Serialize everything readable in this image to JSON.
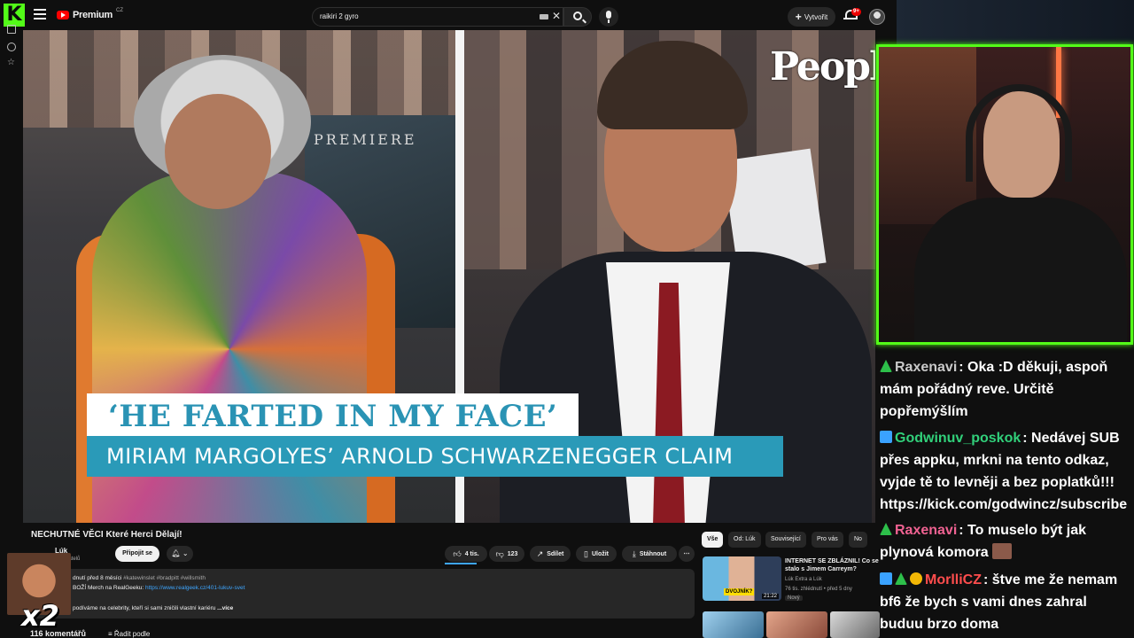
{
  "topbar": {
    "logo_letter": "K",
    "yt_word": "Premium",
    "yt_region": "CZ",
    "search_value": "raikiri 2 gyro",
    "create_label": "Vytvořit",
    "notif_badge": "9+"
  },
  "video": {
    "brand_logo": "People",
    "premiere_text": "PREMIERE",
    "caption_1": "‘HE FARTED IN MY FACE’",
    "caption_2": "MIRIAM MARGOLYES’ ARNOLD SCHWARZENEGGER CLAIM"
  },
  "below": {
    "title": "NECHUTNÉ VĚCI Které Herci Dělají!",
    "channel_name": "Lúk",
    "channel_subs": "odběratelů",
    "join_label": "Připojit se",
    "likes_label": "4 tis.",
    "dislikes_label": "123",
    "share_label": "Sdílet",
    "save_label": "Uložit",
    "download_label": "Stáhnout",
    "more_label": "⋯",
    "desc_line1_meta": "dnutí  před 8 měsíci",
    "desc_line1_tags": "#katewinslet #bradpitt #willsmith",
    "desc_line2_prefix": "BOŽÍ Merch na RealGeeku: ",
    "desc_line2_link": "https://www.realgeek.cz/401-lukuv-svet",
    "desc_line3": "podíváme na celebrity, kteří si sami zničili vlastní kariéru",
    "desc_more": "...více",
    "comments_label": "116 komentářů",
    "sort_label": "Řadit podle"
  },
  "recs": {
    "chips": [
      "Vše",
      "Od: Lúk",
      "Související",
      "Pro vás",
      "No"
    ],
    "item": {
      "title": "INTERNET SE ZBLÁZNIL! Co se stalo s Jimem Carreym?",
      "channel": "Lúk Extra a Lúk",
      "views": "76 tis. zhlédnutí • před 5 dny",
      "badge_new": "Nový",
      "thumb_tag": "DVOJNÍK?",
      "duration": "21:22"
    }
  },
  "overlay": {
    "emote_multiplier": "x2"
  },
  "chat": [
    {
      "user": "Raxenavi",
      "text": ": Oka :D děkuji, aspoň mám pořádný reve. Určitě popřemýšlím"
    },
    {
      "user": "Godwinuv_poskok",
      "text": ": Nedávej SUB přes appku, mrkni na tento odkaz, vyjde tě to levněji a bez poplatků!!! https://kick.com/godwincz/subscribe"
    },
    {
      "user": "Raxenavi",
      "text": ": To muselo být jak plynová komora"
    },
    {
      "user": "MorlliCZ",
      "text": ": štve me že nemam bf6 že bych s vami dnes zahral buduu brzo doma"
    }
  ],
  "colors": {
    "kick_green": "#53fc18",
    "caption_blue": "#2a9ab8",
    "yt_red": "#ff0000",
    "link_blue": "#3ea6ff"
  }
}
